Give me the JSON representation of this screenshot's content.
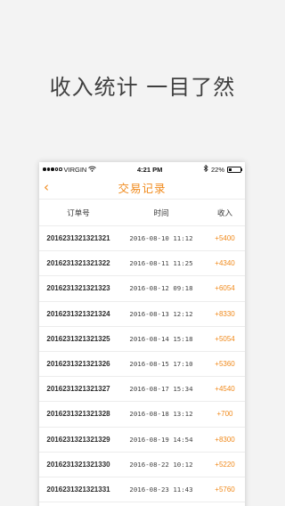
{
  "promo": {
    "headline": "收入统计  一目了然"
  },
  "status_bar": {
    "carrier": "VIRGIN",
    "time": "4:21 PM",
    "battery": "22%",
    "battery_level": 0.22,
    "signal_bars_filled": 3,
    "signal_bars_total": 5
  },
  "nav": {
    "back_icon": "chevron-left-icon",
    "back_glyph": "‹",
    "title": "交易记录"
  },
  "table": {
    "headers": {
      "order": "订单号",
      "time": "时间",
      "income": "收入"
    },
    "rows": [
      {
        "order": "2016231321321321",
        "time": "2016-08-10 11:12",
        "income": "+5400"
      },
      {
        "order": "2016231321321322",
        "time": "2016-08-11 11:25",
        "income": "+4340"
      },
      {
        "order": "2016231321321323",
        "time": "2016-08-12 09:18",
        "income": "+6054"
      },
      {
        "order": "2016231321321324",
        "time": "2016-08-13 12:12",
        "income": "+8330"
      },
      {
        "order": "2016231321321325",
        "time": "2016-08-14 15:18",
        "income": "+5054"
      },
      {
        "order": "2016231321321326",
        "time": "2016-08-15 17:10",
        "income": "+5360"
      },
      {
        "order": "2016231321321327",
        "time": "2016-08-17 15:34",
        "income": "+4540"
      },
      {
        "order": "2016231321321328",
        "time": "2016-08-18 13:12",
        "income": "+700"
      },
      {
        "order": "2016231321321329",
        "time": "2016-08-19 14:54",
        "income": "+8300"
      },
      {
        "order": "2016231321321330",
        "time": "2016-08-22 10:12",
        "income": "+5220"
      },
      {
        "order": "2016231321321331",
        "time": "2016-08-23 11:43",
        "income": "+5760"
      }
    ]
  },
  "colors": {
    "accent": "#f08a1c",
    "background": "#f3f3f3",
    "divider": "#ececec"
  }
}
